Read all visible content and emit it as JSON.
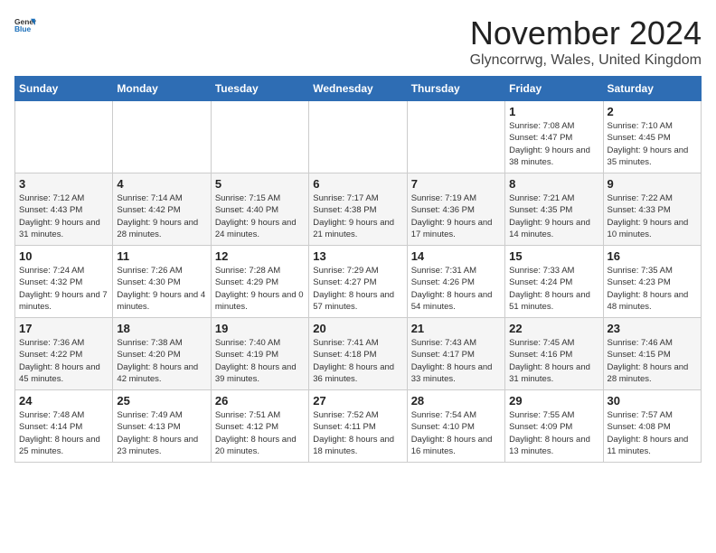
{
  "logo": {
    "text_general": "General",
    "text_blue": "Blue"
  },
  "title": "November 2024",
  "subtitle": "Glyncorrwg, Wales, United Kingdom",
  "days_of_week": [
    "Sunday",
    "Monday",
    "Tuesday",
    "Wednesday",
    "Thursday",
    "Friday",
    "Saturday"
  ],
  "weeks": [
    [
      {
        "day": "",
        "info": ""
      },
      {
        "day": "",
        "info": ""
      },
      {
        "day": "",
        "info": ""
      },
      {
        "day": "",
        "info": ""
      },
      {
        "day": "",
        "info": ""
      },
      {
        "day": "1",
        "info": "Sunrise: 7:08 AM\nSunset: 4:47 PM\nDaylight: 9 hours and 38 minutes."
      },
      {
        "day": "2",
        "info": "Sunrise: 7:10 AM\nSunset: 4:45 PM\nDaylight: 9 hours and 35 minutes."
      }
    ],
    [
      {
        "day": "3",
        "info": "Sunrise: 7:12 AM\nSunset: 4:43 PM\nDaylight: 9 hours and 31 minutes."
      },
      {
        "day": "4",
        "info": "Sunrise: 7:14 AM\nSunset: 4:42 PM\nDaylight: 9 hours and 28 minutes."
      },
      {
        "day": "5",
        "info": "Sunrise: 7:15 AM\nSunset: 4:40 PM\nDaylight: 9 hours and 24 minutes."
      },
      {
        "day": "6",
        "info": "Sunrise: 7:17 AM\nSunset: 4:38 PM\nDaylight: 9 hours and 21 minutes."
      },
      {
        "day": "7",
        "info": "Sunrise: 7:19 AM\nSunset: 4:36 PM\nDaylight: 9 hours and 17 minutes."
      },
      {
        "day": "8",
        "info": "Sunrise: 7:21 AM\nSunset: 4:35 PM\nDaylight: 9 hours and 14 minutes."
      },
      {
        "day": "9",
        "info": "Sunrise: 7:22 AM\nSunset: 4:33 PM\nDaylight: 9 hours and 10 minutes."
      }
    ],
    [
      {
        "day": "10",
        "info": "Sunrise: 7:24 AM\nSunset: 4:32 PM\nDaylight: 9 hours and 7 minutes."
      },
      {
        "day": "11",
        "info": "Sunrise: 7:26 AM\nSunset: 4:30 PM\nDaylight: 9 hours and 4 minutes."
      },
      {
        "day": "12",
        "info": "Sunrise: 7:28 AM\nSunset: 4:29 PM\nDaylight: 9 hours and 0 minutes."
      },
      {
        "day": "13",
        "info": "Sunrise: 7:29 AM\nSunset: 4:27 PM\nDaylight: 8 hours and 57 minutes."
      },
      {
        "day": "14",
        "info": "Sunrise: 7:31 AM\nSunset: 4:26 PM\nDaylight: 8 hours and 54 minutes."
      },
      {
        "day": "15",
        "info": "Sunrise: 7:33 AM\nSunset: 4:24 PM\nDaylight: 8 hours and 51 minutes."
      },
      {
        "day": "16",
        "info": "Sunrise: 7:35 AM\nSunset: 4:23 PM\nDaylight: 8 hours and 48 minutes."
      }
    ],
    [
      {
        "day": "17",
        "info": "Sunrise: 7:36 AM\nSunset: 4:22 PM\nDaylight: 8 hours and 45 minutes."
      },
      {
        "day": "18",
        "info": "Sunrise: 7:38 AM\nSunset: 4:20 PM\nDaylight: 8 hours and 42 minutes."
      },
      {
        "day": "19",
        "info": "Sunrise: 7:40 AM\nSunset: 4:19 PM\nDaylight: 8 hours and 39 minutes."
      },
      {
        "day": "20",
        "info": "Sunrise: 7:41 AM\nSunset: 4:18 PM\nDaylight: 8 hours and 36 minutes."
      },
      {
        "day": "21",
        "info": "Sunrise: 7:43 AM\nSunset: 4:17 PM\nDaylight: 8 hours and 33 minutes."
      },
      {
        "day": "22",
        "info": "Sunrise: 7:45 AM\nSunset: 4:16 PM\nDaylight: 8 hours and 31 minutes."
      },
      {
        "day": "23",
        "info": "Sunrise: 7:46 AM\nSunset: 4:15 PM\nDaylight: 8 hours and 28 minutes."
      }
    ],
    [
      {
        "day": "24",
        "info": "Sunrise: 7:48 AM\nSunset: 4:14 PM\nDaylight: 8 hours and 25 minutes."
      },
      {
        "day": "25",
        "info": "Sunrise: 7:49 AM\nSunset: 4:13 PM\nDaylight: 8 hours and 23 minutes."
      },
      {
        "day": "26",
        "info": "Sunrise: 7:51 AM\nSunset: 4:12 PM\nDaylight: 8 hours and 20 minutes."
      },
      {
        "day": "27",
        "info": "Sunrise: 7:52 AM\nSunset: 4:11 PM\nDaylight: 8 hours and 18 minutes."
      },
      {
        "day": "28",
        "info": "Sunrise: 7:54 AM\nSunset: 4:10 PM\nDaylight: 8 hours and 16 minutes."
      },
      {
        "day": "29",
        "info": "Sunrise: 7:55 AM\nSunset: 4:09 PM\nDaylight: 8 hours and 13 minutes."
      },
      {
        "day": "30",
        "info": "Sunrise: 7:57 AM\nSunset: 4:08 PM\nDaylight: 8 hours and 11 minutes."
      }
    ]
  ]
}
